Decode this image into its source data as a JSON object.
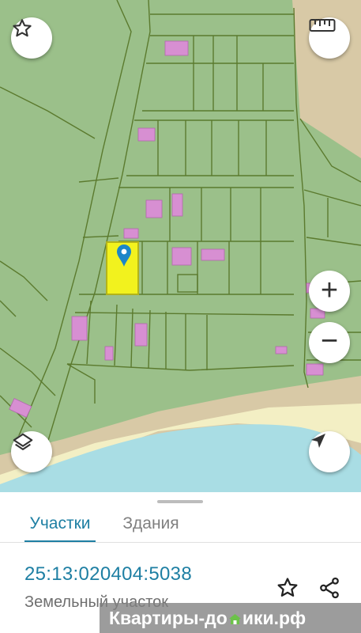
{
  "map": {
    "favorite_icon": "star-outline-icon",
    "ruler_icon": "ruler-icon",
    "zoom_in_label": "+",
    "zoom_out_label": "−",
    "layers_icon": "layers-icon",
    "location_icon": "navigation-arrow-icon",
    "marker_icon": "location-pin-icon",
    "colors": {
      "land": "#9bc08a",
      "parcel_border": "#5b7a2e",
      "building": "#d78fd2",
      "selected_parcel": "#f2f21e",
      "sand": "#d8c9a6",
      "beach": "#f3efc4",
      "water": "#a9dde4",
      "marker": "#1c86c8"
    }
  },
  "sheet": {
    "tabs": [
      {
        "label": "Участки",
        "active": true
      },
      {
        "label": "Здания",
        "active": false
      }
    ],
    "parcel": {
      "cadastral_number": "25:13:020404:5038",
      "type": "Земельный участок"
    },
    "favorite_icon": "star-outline-icon",
    "share_icon": "share-icon",
    "accent_color": "#1e7fa3"
  },
  "watermark": {
    "text_before": "Квартиры-до",
    "text_after": "ики.рф"
  }
}
